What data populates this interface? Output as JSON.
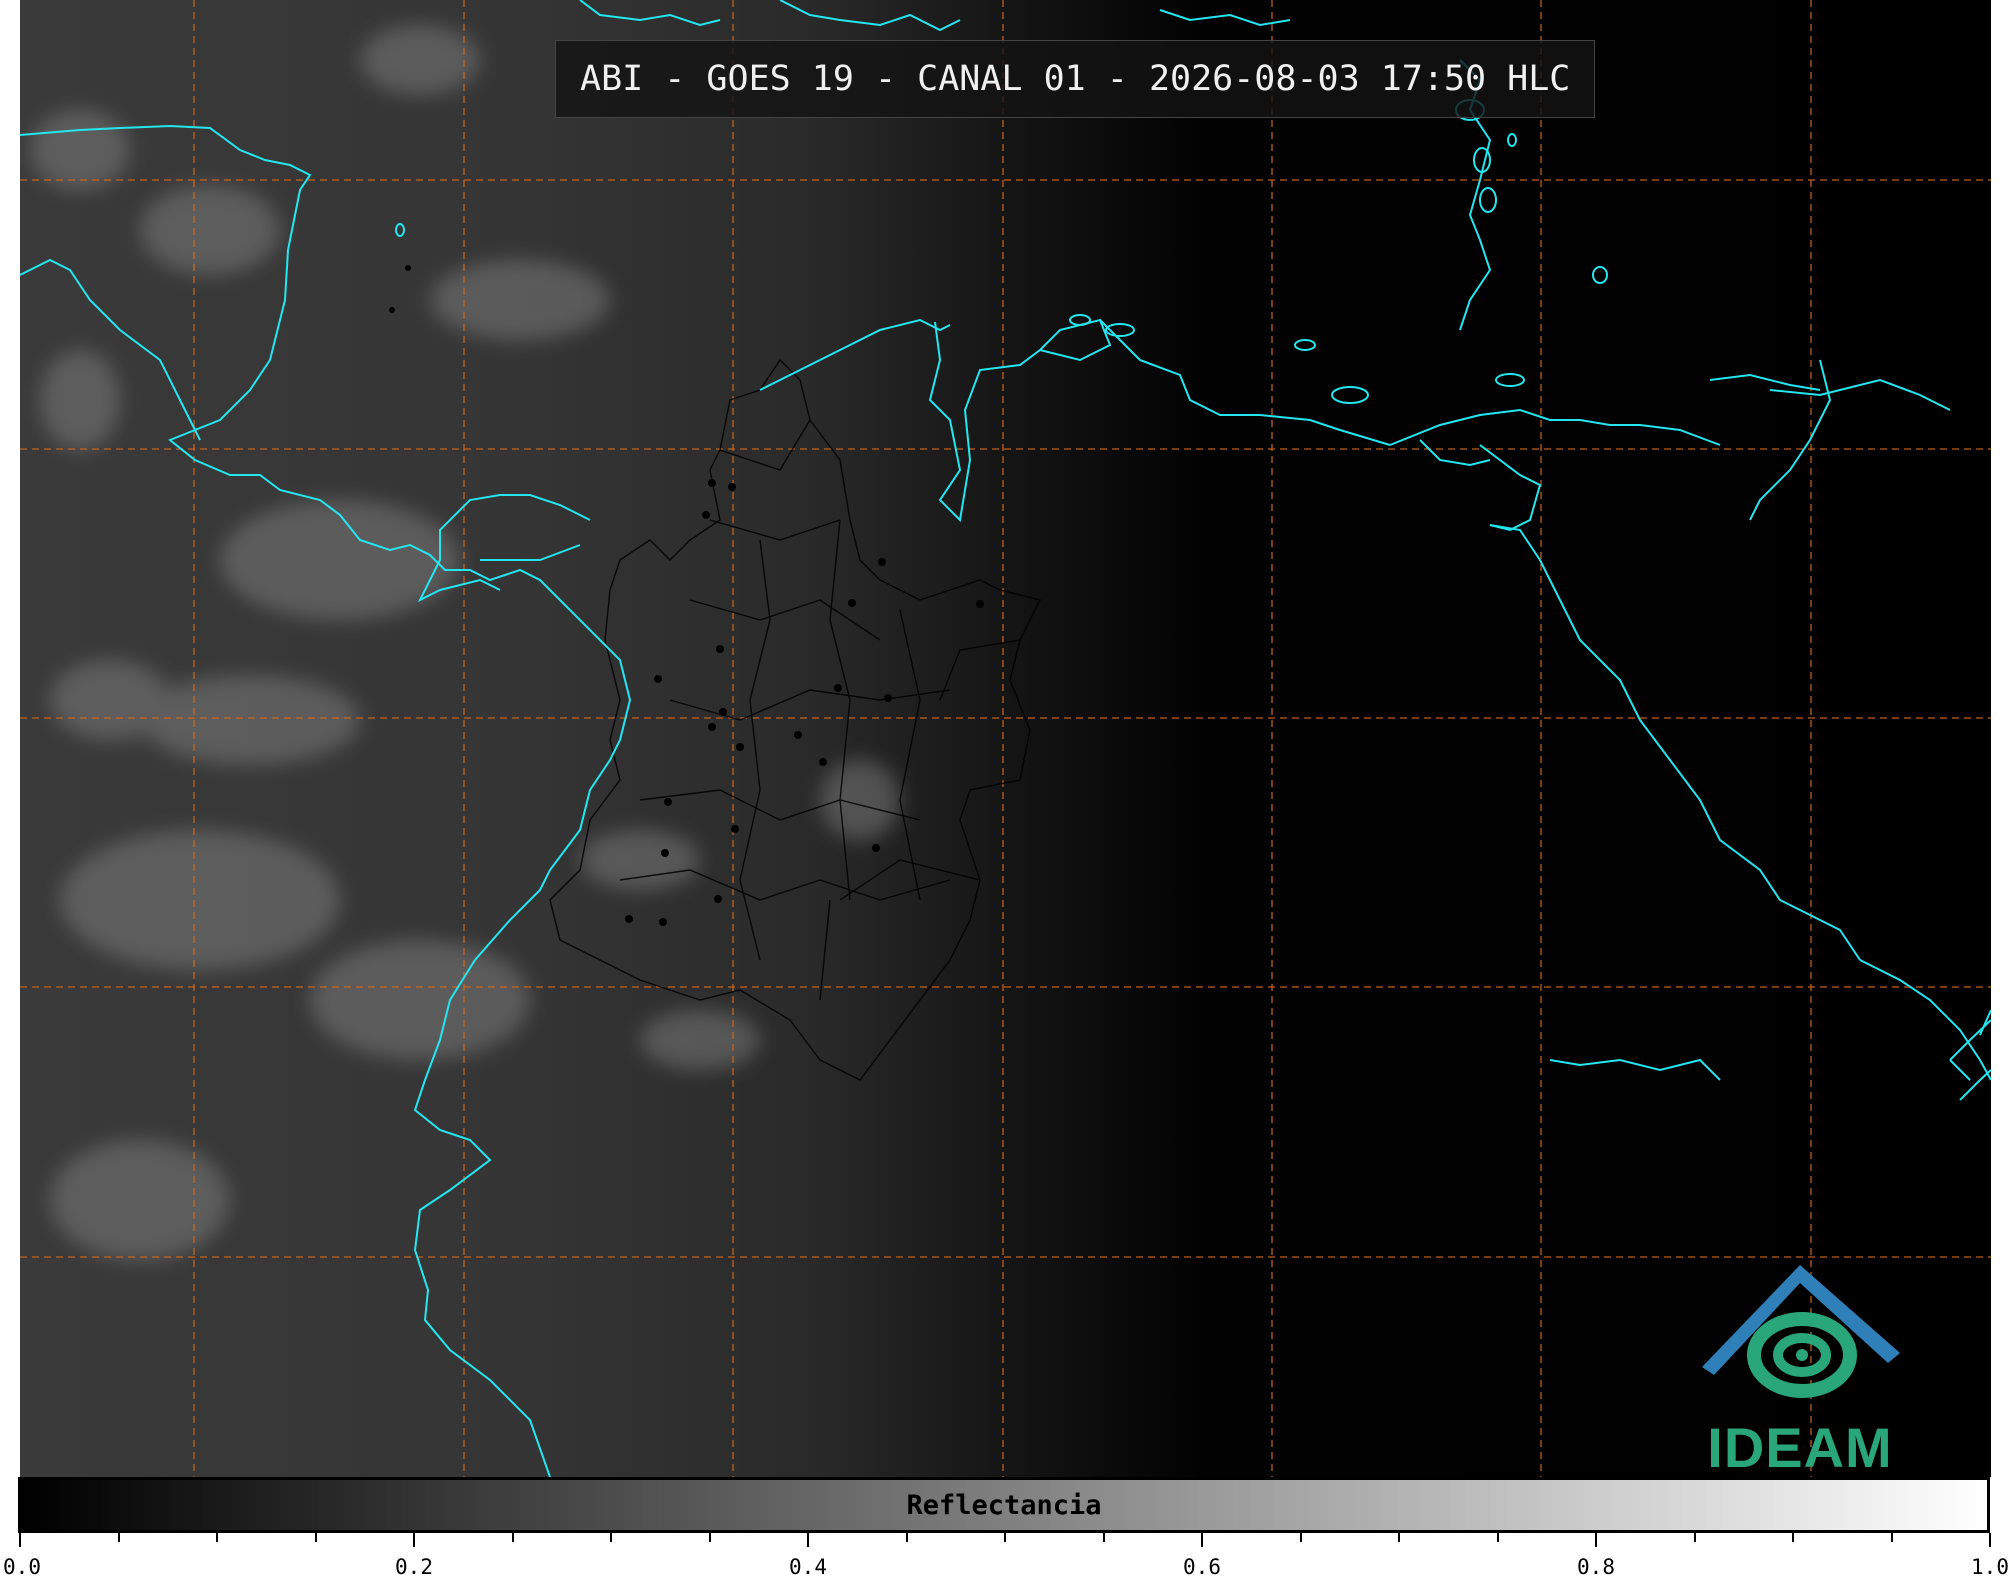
{
  "title": "ABI - GOES 19 - CANAL 01 - 2026-08-03 17:50 HLC",
  "logo": {
    "text": "IDEAM",
    "colors": {
      "triangle": "#2f7fb8",
      "swirl": "#2aa67b"
    }
  },
  "colorbar": {
    "label": "Reflectancia",
    "min": 0.0,
    "max": 1.0,
    "tick_labels": [
      "0.0",
      "0.2",
      "0.4",
      "0.6",
      "0.8",
      "1.0"
    ],
    "colormap": "grayscale black-to-white"
  },
  "map": {
    "coastline_color": "#25e6f0",
    "grid_color": "#d2691e",
    "border_color": "#000000",
    "region": "Colombia, Central America, Caribbean, northern South America",
    "night_side": "east"
  }
}
